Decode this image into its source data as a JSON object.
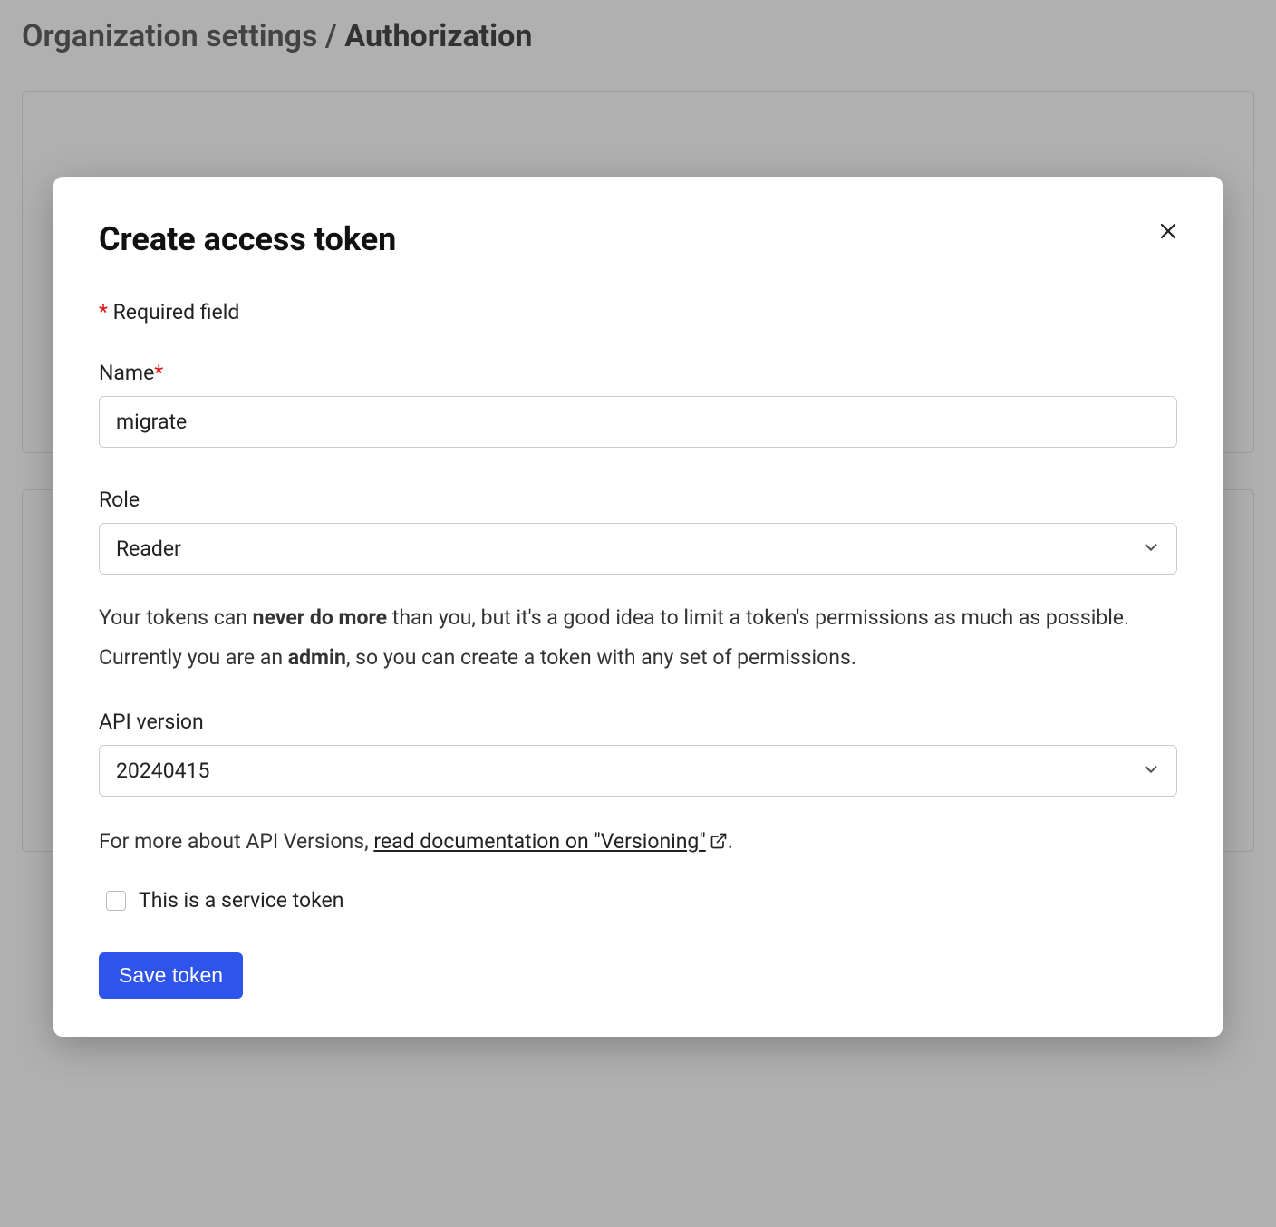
{
  "breadcrumb": {
    "parent": "Organization settings",
    "separator": "/",
    "current": "Authorization"
  },
  "modal": {
    "title": "Create access token",
    "required_note": "Required field",
    "name": {
      "label": "Name",
      "value": "migrate"
    },
    "role": {
      "label": "Role",
      "selected": "Reader"
    },
    "help_line1_pre": "Your tokens can ",
    "help_line1_bold": "never do more",
    "help_line1_post": " than you, but it's a good idea to limit a token's permissions as much as possible.",
    "help_line2_pre": "Currently you are an ",
    "help_line2_bold": "admin",
    "help_line2_post": ", so you can create a token with any set of permissions.",
    "api_version": {
      "label": "API version",
      "selected": "20240415"
    },
    "doc_pre": "For more about API Versions, ",
    "doc_link": "read documentation on \"Versioning\"",
    "doc_post": ".",
    "service_token_label": "This is a service token",
    "save_label": "Save token"
  }
}
